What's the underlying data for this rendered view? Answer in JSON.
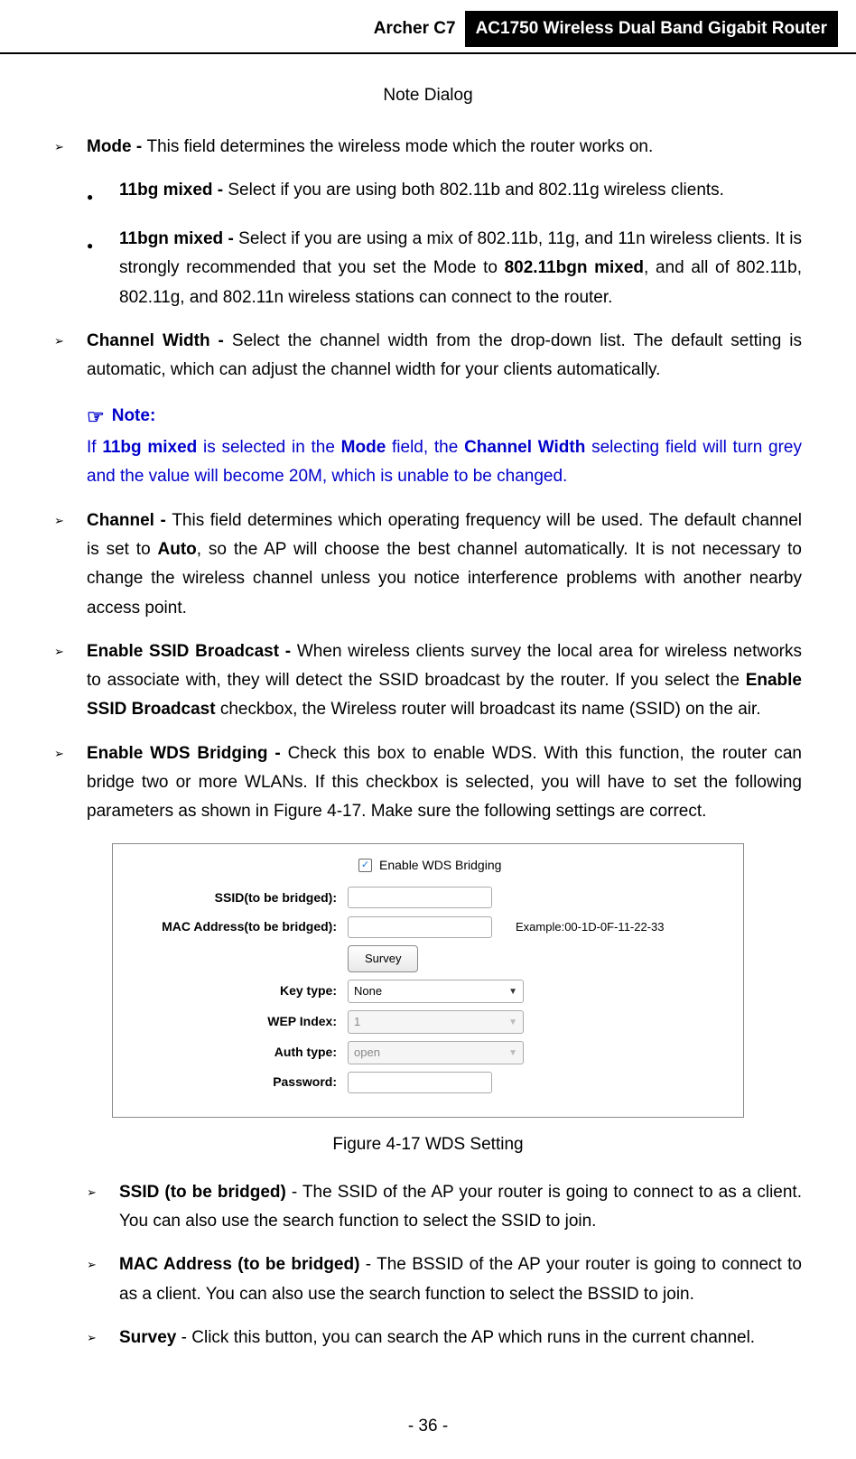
{
  "header": {
    "model": "Archer C7",
    "title": "AC1750 Wireless Dual Band Gigabit Router"
  },
  "noteDialog": "Note Dialog",
  "items": {
    "mode": {
      "label": "Mode - ",
      "text": "This field determines the wireless mode which the router works on."
    },
    "bg": {
      "label": "11bg mixed - ",
      "text": "Select if you are using both 802.11b and 802.11g wireless clients."
    },
    "bgn": {
      "label": "11bgn mixed - ",
      "text1": "Select if you are using a mix of 802.11b, 11g, and 11n wireless clients. It is strongly recommended that you set the Mode to ",
      "bold": "802.11bgn mixed",
      "text2": ", and all of 802.11b, 802.11g, and 802.11n wireless stations can connect to the router."
    },
    "channelWidth": {
      "label": "Channel Width - ",
      "text": "Select the channel width from the drop-down list. The default setting is automatic, which can adjust the channel width for your clients automatically."
    },
    "note": {
      "icon": "☞",
      "header": "Note:",
      "pre": "If ",
      "b1": "11bg mixed",
      "mid1": " is selected in the ",
      "b2": "Mode",
      "mid2": " field, the ",
      "b3": "Channel Width",
      "post": " selecting field will turn grey and the value will become 20M, which is unable to be changed."
    },
    "channel": {
      "label": "Channel - ",
      "text1": "This field determines which operating frequency will be used. The default channel is set to ",
      "bold": "Auto",
      "text2": ", so the AP will choose the best channel automatically. It is not necessary to change the wireless channel unless you notice interference problems with another nearby access point."
    },
    "ssidBroadcast": {
      "label": "Enable SSID Broadcast - ",
      "text1": "When wireless clients survey the local area for wireless networks to associate with, they will detect the SSID broadcast by the router. If you select the ",
      "bold": "Enable SSID Broadcast",
      "text2": " checkbox, the Wireless router will broadcast its name (SSID) on the air."
    },
    "wds": {
      "label": "Enable WDS Bridging - ",
      "text": "Check this box to enable WDS. With this function, the router can bridge two or more WLANs. If this checkbox is selected, you will have to set the following parameters as shown in Figure 4-17. Make sure the following settings are correct."
    },
    "ssidBridged": {
      "label": "SSID (to be bridged)",
      "text": " - The SSID of the AP your router is going to connect to as a client. You can also use the search function to select the SSID to join."
    },
    "macBridged": {
      "label": "MAC Address (to be bridged)",
      "text": " - The BSSID of the AP your router is going to connect to as a client. You can also use the search function to select the BSSID to join."
    },
    "survey": {
      "label": "Survey",
      "text": " - Click this button, you can search the AP which runs in the current channel."
    }
  },
  "figure": {
    "checkboxLabel": "Enable WDS Bridging",
    "ssidLabel": "SSID(to be bridged):",
    "macLabel": "MAC Address(to be bridged):",
    "macExample": "Example:00-1D-0F-11-22-33",
    "surveyBtn": "Survey",
    "keyTypeLabel": "Key type:",
    "keyTypeValue": "None",
    "wepLabel": "WEP Index:",
    "wepValue": "1",
    "authLabel": "Auth type:",
    "authValue": "open",
    "passwordLabel": "Password:",
    "caption": "Figure 4-17 WDS Setting"
  },
  "footer": "- 36 -"
}
